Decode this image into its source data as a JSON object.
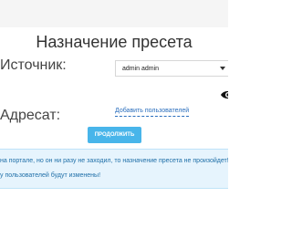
{
  "form": {
    "title": "Назначение пресета",
    "source_label": "Источник:",
    "source_select": {
      "selected_value": "admin admin"
    },
    "destination_label": "Адресат:",
    "add_users_link": "Добавить пользователей",
    "continue_button": "ПРОДОЛЖИТЬ",
    "visibility_icon": "eye-icon"
  },
  "alert": {
    "line1": "на портале, но он ни разу не заходил, то назначение пресета не произойдет!",
    "line2": "у пользователей будут изменены!"
  },
  "colors": {
    "accent": "#48b5ea",
    "link": "#2a6ebd",
    "alert_background": "#e6f4fd",
    "alert_text": "#1f6fa8"
  }
}
